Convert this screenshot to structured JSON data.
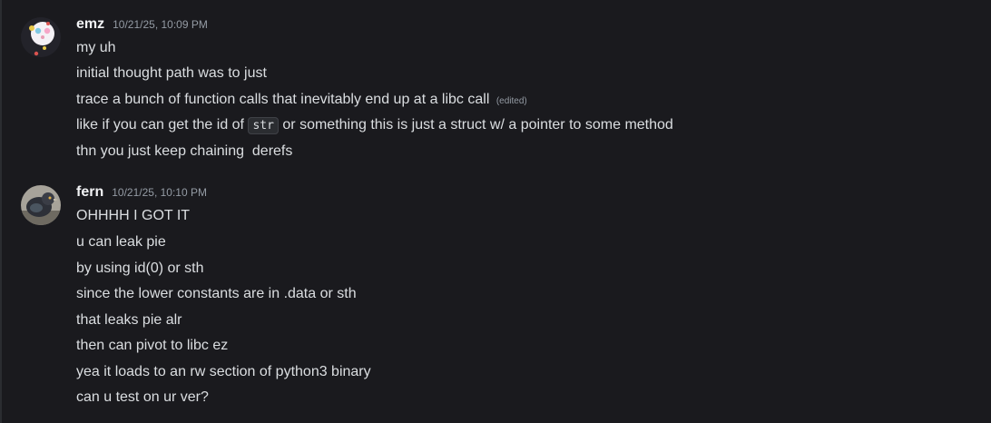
{
  "messages": [
    {
      "author": "emz",
      "timestamp": "10/21/25, 10:09 PM",
      "avatar_icon": "cat-avatar-icon",
      "lines": {
        "l0": "my uh",
        "l1": "initial thought path was to just",
        "l2": "trace a bunch of function calls that inevitably end up at a libc call",
        "l2_edited": "(edited)",
        "l3_before": "like if you can get the id of",
        "l3_code": "str",
        "l3_after": "or something this is just a struct w/ a pointer to some method",
        "l4": "thn you just keep chaining  derefs"
      }
    },
    {
      "author": "fern",
      "timestamp": "10/21/25, 10:10 PM",
      "avatar_icon": "bird-avatar-icon",
      "lines": [
        "OHHHH I GOT IT",
        "u can leak pie",
        "by using id(0) or sth",
        "since the lower constants are in .data or sth",
        "that leaks pie alr",
        "then can pivot to libc ez",
        "yea it loads to an rw section of python3 binary",
        "can u test on ur ver?"
      ]
    }
  ],
  "colors": {
    "background": "#1a1a1e",
    "username": "#f2f3f5",
    "message_text": "#dbdee1",
    "timestamp": "#949ba4",
    "code_bg": "#2b2d31"
  }
}
